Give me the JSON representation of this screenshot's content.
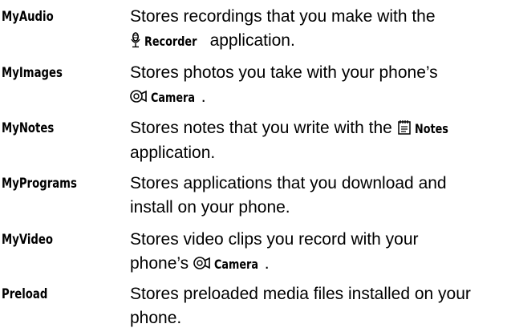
{
  "entries": [
    {
      "term": "MyAudio",
      "line1": "Stores recordings that you make with the",
      "icon": "microphone-icon",
      "app": "Recorder",
      "line2_after": " application."
    },
    {
      "term": "MyImages",
      "line1": "Stores photos you take with your phone’s",
      "icon": "camera-icon",
      "app": "Camera",
      "line2_after": "."
    },
    {
      "term": "MyNotes",
      "line1_before": "Stores notes that you write with the ",
      "icon": "notes-icon",
      "app": "Notes",
      "line2": "application."
    },
    {
      "term": "MyPrograms",
      "line1": "Stores applications that you download and",
      "line2": "install on your phone."
    },
    {
      "term": "MyVideo",
      "line1": "Stores video clips you record with your",
      "line2_before": "phone’s ",
      "icon": "camera-icon",
      "app": "Camera",
      "line2_after": "."
    },
    {
      "term": "Preload",
      "line1": "Stores preloaded media files installed on your",
      "line2": "phone."
    }
  ]
}
